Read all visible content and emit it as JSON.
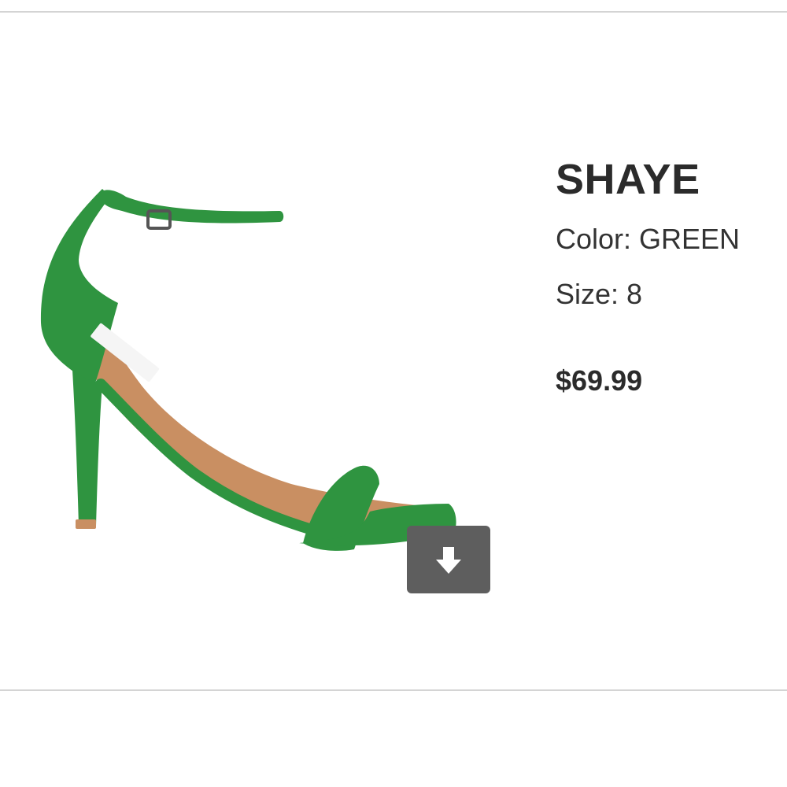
{
  "product": {
    "name": "SHAYE",
    "color_text": "Color: GREEN",
    "size_text": "Size: 8",
    "price": "$69.99",
    "image_icon": "green-high-heel-sandal",
    "shoe_color": "#2f9440"
  },
  "actions": {
    "download_icon": "download-arrow-icon"
  }
}
